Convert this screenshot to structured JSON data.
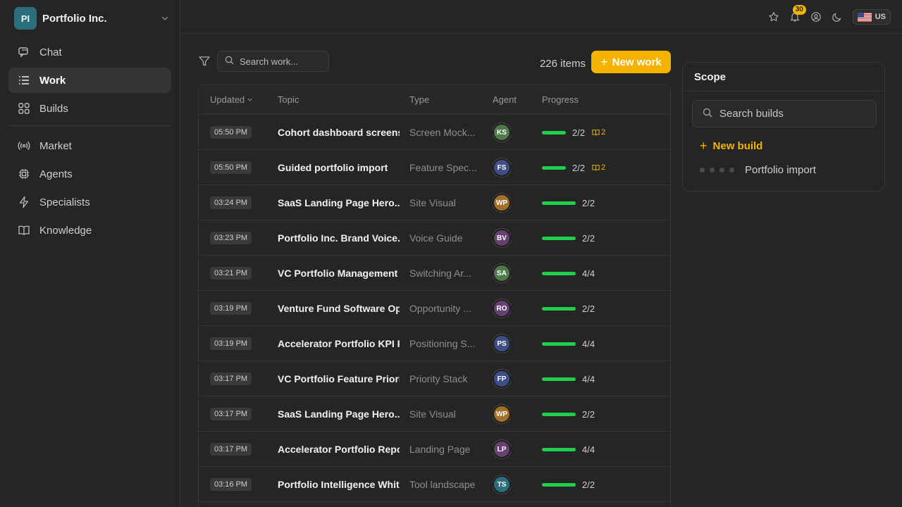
{
  "org": {
    "initials": "PI",
    "name": "Portfolio Inc."
  },
  "nav": {
    "primary": [
      {
        "label": "Chat",
        "icon": "chat-icon",
        "active": false
      },
      {
        "label": "Work",
        "icon": "list-icon",
        "active": true
      },
      {
        "label": "Builds",
        "icon": "grid-icon",
        "active": false
      }
    ],
    "secondary": [
      {
        "label": "Market",
        "icon": "broadcast-icon"
      },
      {
        "label": "Agents",
        "icon": "cpu-icon"
      },
      {
        "label": "Specialists",
        "icon": "bolt-icon"
      },
      {
        "label": "Knowledge",
        "icon": "book-icon"
      }
    ]
  },
  "topbar": {
    "notifications": "30",
    "locale": "US"
  },
  "toolbar": {
    "search_placeholder": "Search work...",
    "count": "226 items",
    "new_work": "New work"
  },
  "table": {
    "columns": {
      "updated": "Updated",
      "topic": "Topic",
      "type": "Type",
      "agent": "Agent",
      "progress": "Progress"
    },
    "rows": [
      {
        "time": "05:50 PM",
        "topic": "Cohort dashboard screens",
        "type": "Screen Mock...",
        "agent": "KS",
        "agent_color": "#4f7a4a",
        "progress": "2/2",
        "docs": "2"
      },
      {
        "time": "05:50 PM",
        "topic": "Guided portfolio import",
        "type": "Feature Spec...",
        "agent": "FS",
        "agent_color": "#3f4e86",
        "progress": "2/2",
        "docs": "2"
      },
      {
        "time": "03:24 PM",
        "topic": "SaaS Landing Page Hero...",
        "type": "Site Visual",
        "agent": "WP",
        "agent_color": "#a2702a",
        "progress": "2/2",
        "docs": ""
      },
      {
        "time": "03:23 PM",
        "topic": "Portfolio Inc. Brand Voice...",
        "type": "Voice Guide",
        "agent": "BV",
        "agent_color": "#66406f",
        "progress": "2/2",
        "docs": ""
      },
      {
        "time": "03:21 PM",
        "topic": "VC Portfolio Management",
        "type": "Switching Ar...",
        "agent": "SA",
        "agent_color": "#4f7a4a",
        "progress": "4/4",
        "docs": ""
      },
      {
        "time": "03:19 PM",
        "topic": "Venture Fund Software Op",
        "type": "Opportunity ...",
        "agent": "RO",
        "agent_color": "#66406f",
        "progress": "2/2",
        "docs": ""
      },
      {
        "time": "03:19 PM",
        "topic": "Accelerator Portfolio KPI F",
        "type": "Positioning S...",
        "agent": "PS",
        "agent_color": "#3f4e86",
        "progress": "4/4",
        "docs": ""
      },
      {
        "time": "03:17 PM",
        "topic": "VC Portfolio Feature Priori",
        "type": "Priority Stack",
        "agent": "FP",
        "agent_color": "#3f4e86",
        "progress": "4/4",
        "docs": ""
      },
      {
        "time": "03:17 PM",
        "topic": "SaaS Landing Page Hero...",
        "type": "Site Visual",
        "agent": "WP",
        "agent_color": "#a2702a",
        "progress": "2/2",
        "docs": ""
      },
      {
        "time": "03:17 PM",
        "topic": "Accelerator Portfolio Repo",
        "type": "Landing Page",
        "agent": "LP",
        "agent_color": "#66406f",
        "progress": "4/4",
        "docs": ""
      },
      {
        "time": "03:16 PM",
        "topic": "Portfolio Intelligence Whit",
        "type": "Tool landscape",
        "agent": "TS",
        "agent_color": "#2b6f7d",
        "progress": "2/2",
        "docs": ""
      }
    ]
  },
  "scope": {
    "title": "Scope",
    "search_placeholder": "Search builds",
    "new_build": "New build",
    "builds": [
      {
        "label": "Portfolio import"
      }
    ]
  },
  "colors": {
    "accent": "#f5b301",
    "progress": "#1fcf4d",
    "background": "#252525"
  }
}
